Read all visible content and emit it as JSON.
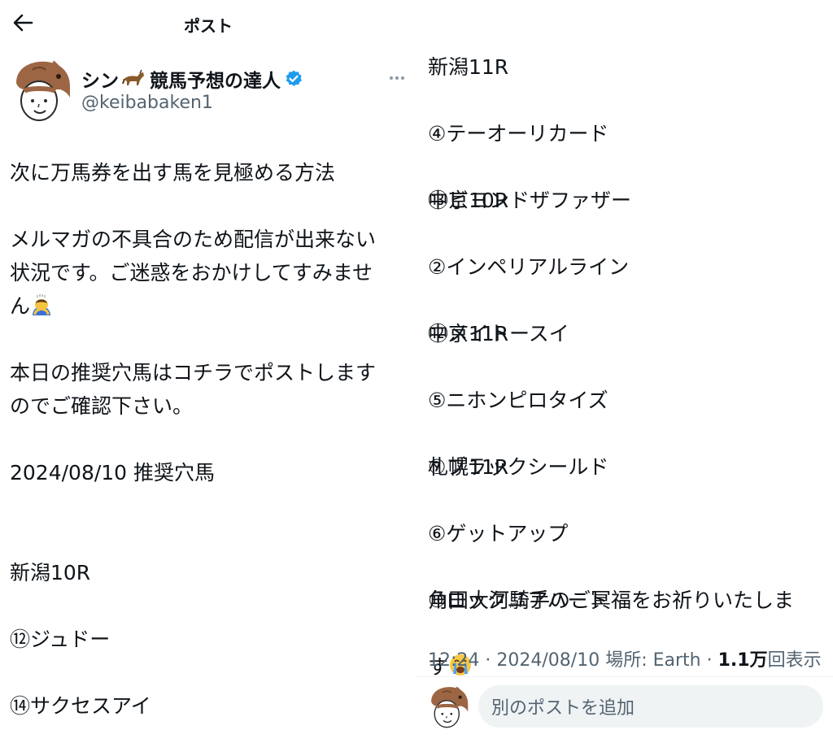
{
  "header": {
    "title": "ポスト",
    "back_icon": "arrow-left-icon"
  },
  "author": {
    "name_before": "シン",
    "name_after": "競馬予想の達人",
    "handle": "@keibabaken1",
    "verified": true
  },
  "post": {
    "p1": "次に万馬券を出す馬を見極める方法",
    "p2": "メルマガの不具合のため配信が出来ない\n状況です。ご迷惑をおかけしてすみませ\nん",
    "p3": "本日の推奨穴馬はコチラでポストします\nのでご確認下さい。",
    "p4": "2024/08/10 推奨穴馬",
    "races": [
      {
        "race": "新潟10R",
        "horses": [
          "⑫ジュドー",
          "⑭サクセスアイ"
        ]
      },
      {
        "race": "新潟11R",
        "horses": [
          "④テーオーリカード",
          "⑬ビヨンドザファザー"
        ]
      },
      {
        "race": "中京10R",
        "horses": [
          "②インペリアルライン",
          "⑫メイトースイ"
        ]
      },
      {
        "race": "中京11R",
        "horses": [
          "⑤ニホンピロタイズ",
          "⑦ブラックシールド"
        ]
      },
      {
        "race": "札幌11R",
        "horses": [
          "⑥ゲットアップ",
          "⑩ロックユアハート"
        ]
      }
    ],
    "closing_line1": "角田大河騎手のご冥福をお祈りいたしま",
    "closing_line2": "す"
  },
  "meta": {
    "time": "12:24",
    "date": "2024/08/10",
    "location": "場所: Earth",
    "views_count": "1.1万",
    "views_label": "回表示"
  },
  "reply": {
    "placeholder": "別のポストを追加"
  },
  "colors": {
    "text": "#0f1419",
    "secondary": "#536471",
    "verified": "#1d9bf0",
    "divider": "#eff3f4"
  }
}
